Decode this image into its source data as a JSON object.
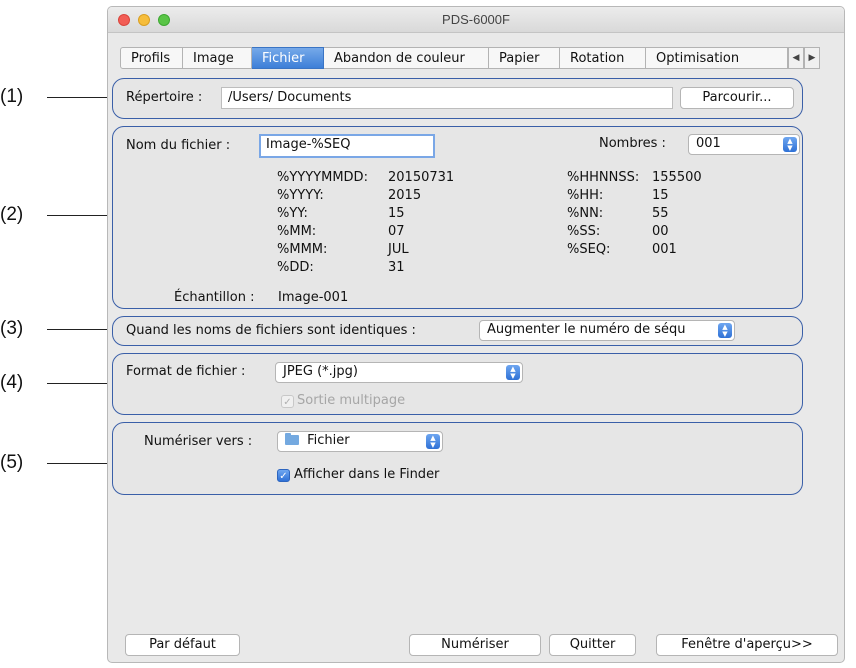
{
  "callouts": [
    "(1)",
    "(2)",
    "(3)",
    "(4)",
    "(5)"
  ],
  "window": {
    "title": "PDS-6000F"
  },
  "tabs": [
    "Profils",
    "Image",
    "Fichier",
    "Abandon de couleur",
    "Papier",
    "Rotation",
    "Optimisation"
  ],
  "active_tab": "Fichier",
  "section1": {
    "label": "Répertoire :",
    "path": "/Users/ Documents",
    "browse": "Parcourir..."
  },
  "section2": {
    "filename_label": "Nom du fichier :",
    "filename_value": "Image-%SEQ",
    "numbers_label": "Nombres :",
    "numbers_value": "001",
    "left_codes": [
      {
        "code": "%YYYYMMDD:",
        "value": "20150731"
      },
      {
        "code": "%YYYY:",
        "value": "2015"
      },
      {
        "code": "%YY:",
        "value": "15"
      },
      {
        "code": "%MM:",
        "value": "07"
      },
      {
        "code": "%MMM:",
        "value": "JUL"
      },
      {
        "code": "%DD:",
        "value": "31"
      }
    ],
    "right_codes": [
      {
        "code": "%HHNNSS:",
        "value": "155500"
      },
      {
        "code": "%HH:",
        "value": "15"
      },
      {
        "code": "%NN:",
        "value": "55"
      },
      {
        "code": "%SS:",
        "value": "00"
      },
      {
        "code": "%SEQ:",
        "value": "001"
      }
    ],
    "sample_label": "Échantillon :",
    "sample_value": "Image-001"
  },
  "section3": {
    "label": "Quand les noms de fichiers sont identiques :",
    "value": "Augmenter le numéro de séqu"
  },
  "section4": {
    "label": "Format de fichier :",
    "value": "JPEG (*.jpg)",
    "multipage_label": "Sortie multipage",
    "multipage_checked": true,
    "multipage_enabled": false
  },
  "section5": {
    "label": "Numériser vers :",
    "value": "Fichier",
    "finder_label": "Afficher dans le Finder",
    "finder_checked": true
  },
  "buttons": {
    "default": "Par défaut",
    "scan": "Numériser",
    "quit": "Quitter",
    "preview": "Fenêtre d'aperçu>>"
  },
  "colors": {
    "section_border": "#3a5fa8",
    "accent": "#3d7fd8"
  }
}
